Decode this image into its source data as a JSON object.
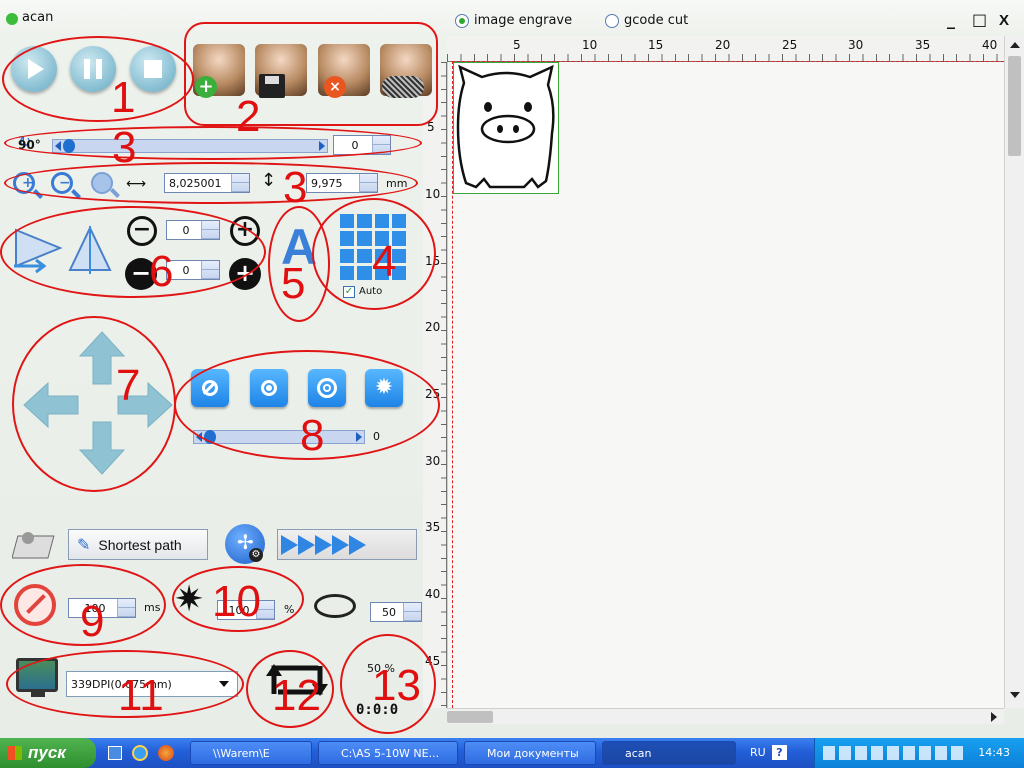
{
  "window": {
    "title": "acan"
  },
  "mode": {
    "options": [
      "image engrave",
      "gcode cut"
    ],
    "selected": "image engrave"
  },
  "window_controls": {
    "minimize": "_",
    "maximize": "□",
    "close": "X"
  },
  "rotate": {
    "label": "90°",
    "value": "0"
  },
  "size": {
    "width": "8,025001",
    "height": "9,975",
    "unit": "mm"
  },
  "offset": {
    "x": "0",
    "y": "0"
  },
  "grid_auto": {
    "label": "Auto",
    "checked": true
  },
  "power_slider": {
    "value": "0",
    "fraction": 0.0
  },
  "shortest_path": {
    "label": "Shortest path"
  },
  "burn_time": {
    "value": "100",
    "unit": "ms"
  },
  "laser_power": {
    "value": "100",
    "unit": "%"
  },
  "depth": {
    "value": "50"
  },
  "resolution": {
    "selected": "339DPI(0.075mm)"
  },
  "progress": {
    "percent": "50 %",
    "time": "0:0:0"
  },
  "ruler": {
    "top": [
      "5",
      "10",
      "15",
      "20",
      "25",
      "30",
      "35",
      "40"
    ],
    "left": [
      "5",
      "10",
      "15",
      "20",
      "25",
      "30",
      "35",
      "40",
      "45"
    ]
  },
  "annotations": [
    "1",
    "2",
    "3",
    "3",
    "4",
    "5",
    "6",
    "7",
    "8",
    "9",
    "10",
    "11",
    "12",
    "13"
  ],
  "taskbar": {
    "start": "пуск",
    "tasks": [
      "\\\\Warem\\E",
      "C:\\AS 5-10W NE...",
      "Мои документы",
      "acan"
    ],
    "lang": "RU",
    "clock": "14:43"
  },
  "colors": {
    "accent": "#1e84e6",
    "annotation": "#e01010",
    "taskbar": "#245edb"
  }
}
